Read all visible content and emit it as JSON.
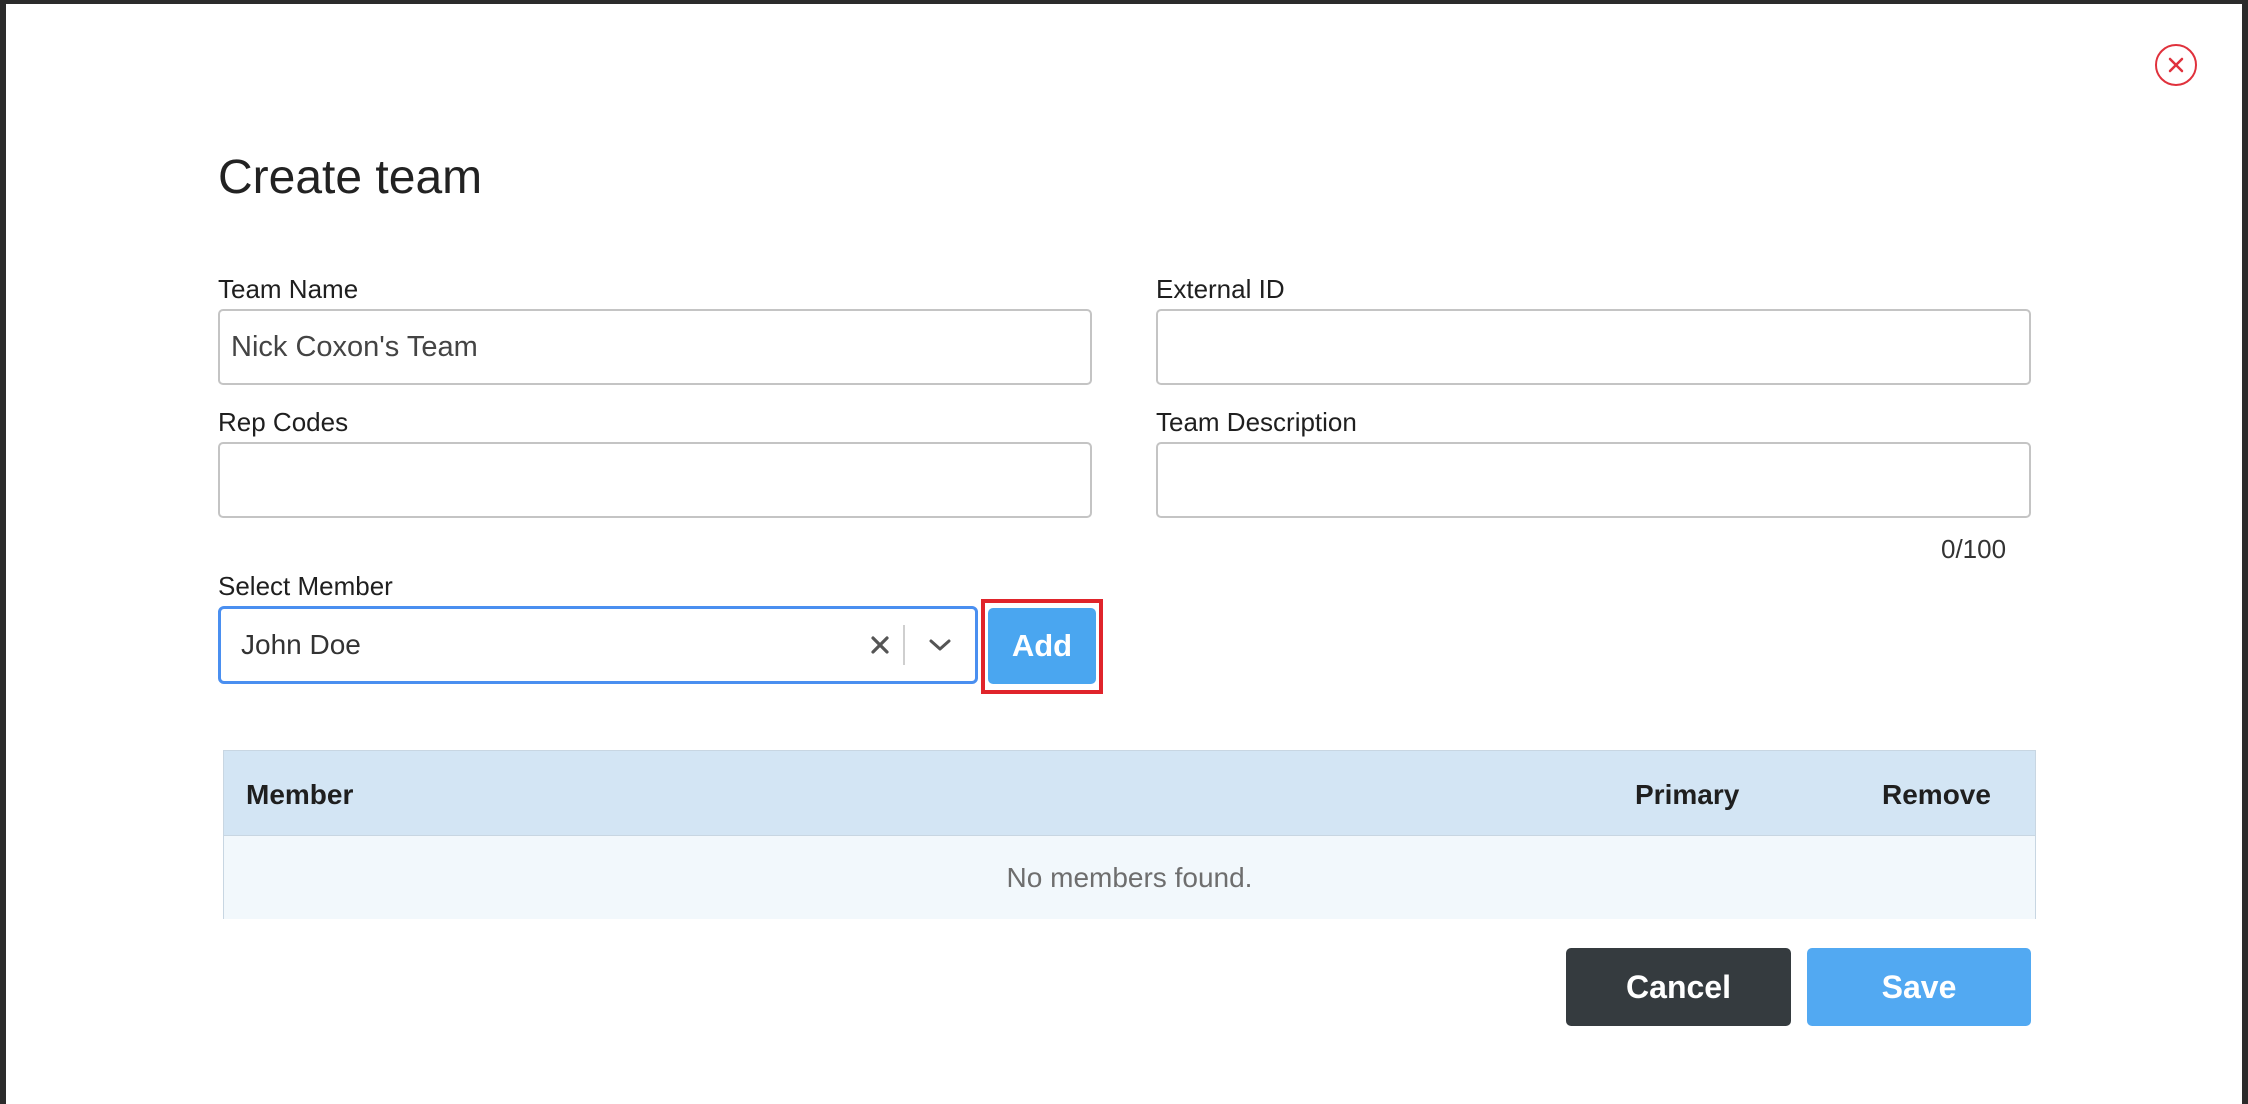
{
  "dialog": {
    "title": "Create team"
  },
  "form": {
    "team_name": {
      "label": "Team Name",
      "value": "Nick Coxon's Team"
    },
    "external_id": {
      "label": "External ID",
      "value": ""
    },
    "rep_codes": {
      "label": "Rep Codes",
      "value": ""
    },
    "team_description": {
      "label": "Team Description",
      "value": "",
      "counter": "0/100"
    },
    "select_member": {
      "label": "Select Member",
      "value": "John Doe"
    },
    "add_label": "Add"
  },
  "members_table": {
    "columns": [
      "Member",
      "Primary",
      "Remove"
    ],
    "empty_message": "No members found."
  },
  "actions": {
    "cancel_label": "Cancel",
    "save_label": "Save"
  },
  "colors": {
    "accent": "#4aa6f0",
    "close": "#e0313c",
    "highlight": "#e0242b",
    "cancel_bg": "#353b3f"
  }
}
